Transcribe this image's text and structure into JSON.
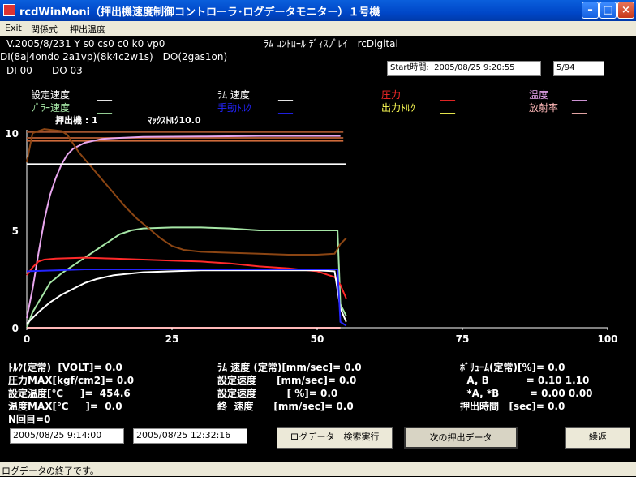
{
  "window": {
    "title": "rcdWinMoni（押出機速度制御コントローラ･ログデータモニター）１号機"
  },
  "menu": [
    "Exit",
    "関係式",
    "押出温度"
  ],
  "info": {
    "version": "V.2005/8/231 Y s0 cs0 c0 k0 vp0",
    "display_name": "ﾗﾑ ｺﾝﾄﾛｰﾙ ﾃﾞｨｽﾌﾟﾚｲ　rcDigital",
    "di_line": "DI(8aj4ondo 2a1vp)(8k4c2w1s)　DO(2gas1on)",
    "di": "DI 00",
    "do": "DO 03",
    "start_label": "Start時間:",
    "start_time": "2005/08/25 9:20:55",
    "page": "5/94"
  },
  "legend": {
    "set_speed": {
      "label": "設定速度",
      "value": "___"
    },
    "ram_speed": {
      "label": "ﾗﾑ 速度",
      "value": "___"
    },
    "pressure": {
      "label": "圧力",
      "value": "___"
    },
    "temperature": {
      "label": "温度",
      "value": "___"
    },
    "puller_speed": {
      "label": "ﾌﾟﾗｰ速度",
      "value": "___"
    },
    "manual_torque": {
      "label": "手動ﾄﾙｸ",
      "value": "___"
    },
    "output_torque": {
      "label": "出力ﾄﾙｸ",
      "value": "___"
    },
    "radiation": {
      "label": "放射率",
      "value": "___"
    },
    "extruder": "押出機 : 1",
    "max_torque": "ﾏｯｸｽﾄﾙｸ10.0"
  },
  "chart_data": {
    "type": "line",
    "xlim": [
      0,
      100
    ],
    "ylim": [
      0,
      10
    ],
    "x_ticks": [
      "0",
      "25",
      "50",
      "75",
      "100"
    ],
    "y_ticks": [
      "0",
      "5",
      "10"
    ],
    "series": [
      {
        "name": "温度",
        "color": "#e8a6ee",
        "points": [
          [
            0,
            0.5
          ],
          [
            1,
            2
          ],
          [
            2,
            3.8
          ],
          [
            3,
            5.5
          ],
          [
            4,
            6.8
          ],
          [
            5,
            7.7
          ],
          [
            6,
            8.4
          ],
          [
            7,
            8.9
          ],
          [
            8,
            9.2
          ],
          [
            10,
            9.5
          ],
          [
            13,
            9.7
          ],
          [
            16,
            9.75
          ],
          [
            20,
            9.8
          ],
          [
            30,
            9.82
          ],
          [
            40,
            9.85
          ],
          [
            50,
            9.85
          ],
          [
            54,
            9.85
          ]
        ]
      },
      {
        "name": "ﾌﾟﾗｰ速度",
        "color": "#a6e6a6",
        "points": [
          [
            0,
            0
          ],
          [
            1,
            0.8
          ],
          [
            2,
            1.3
          ],
          [
            3,
            1.8
          ],
          [
            4,
            2.3
          ],
          [
            6,
            2.8
          ],
          [
            8,
            3.2
          ],
          [
            10,
            3.6
          ],
          [
            12,
            4.0
          ],
          [
            14,
            4.4
          ],
          [
            16,
            4.8
          ],
          [
            18,
            5.0
          ],
          [
            20,
            5.1
          ],
          [
            25,
            5.15
          ],
          [
            30,
            5.15
          ],
          [
            35,
            5.1
          ],
          [
            40,
            5.0
          ],
          [
            45,
            5.0
          ],
          [
            50,
            5.0
          ],
          [
            53.5,
            5.0
          ],
          [
            54,
            1.2
          ],
          [
            55,
            0.6
          ]
        ]
      },
      {
        "name": "圧力",
        "color": "#ff2a2a",
        "points": [
          [
            0,
            2.7
          ],
          [
            1,
            3.1
          ],
          [
            2,
            3.4
          ],
          [
            3,
            3.5
          ],
          [
            5,
            3.55
          ],
          [
            10,
            3.6
          ],
          [
            15,
            3.55
          ],
          [
            20,
            3.5
          ],
          [
            25,
            3.45
          ],
          [
            30,
            3.4
          ],
          [
            35,
            3.3
          ],
          [
            40,
            3.15
          ],
          [
            45,
            3.05
          ],
          [
            50,
            2.9
          ],
          [
            53,
            2.6
          ],
          [
            54,
            2.2
          ],
          [
            55,
            1.5
          ]
        ]
      },
      {
        "name": "ﾗﾑ 速度",
        "color": "#ffffff",
        "points": [
          [
            0,
            0.2
          ],
          [
            2,
            0.8
          ],
          [
            4,
            1.3
          ],
          [
            6,
            1.7
          ],
          [
            8,
            2.0
          ],
          [
            10,
            2.3
          ],
          [
            12,
            2.5
          ],
          [
            15,
            2.7
          ],
          [
            20,
            2.85
          ],
          [
            25,
            2.9
          ],
          [
            30,
            2.95
          ],
          [
            35,
            2.95
          ],
          [
            40,
            2.95
          ],
          [
            45,
            2.95
          ],
          [
            50,
            2.95
          ],
          [
            53,
            2.9
          ],
          [
            54,
            1.0
          ],
          [
            55,
            0.3
          ]
        ]
      },
      {
        "name": "手動ﾄﾙｸ",
        "color": "#2424ff",
        "points": [
          [
            0,
            2.9
          ],
          [
            5,
            2.95
          ],
          [
            10,
            3.0
          ],
          [
            20,
            3.0
          ],
          [
            30,
            3.0
          ],
          [
            40,
            3.0
          ],
          [
            50,
            3.0
          ],
          [
            53.5,
            3.0
          ],
          [
            54,
            0.3
          ],
          [
            55,
            0.1
          ]
        ]
      },
      {
        "name": "出力ﾄﾙｸ",
        "color": "#8b4513",
        "points": [
          [
            0,
            8.5
          ],
          [
            1,
            10.0
          ],
          [
            3,
            10.2
          ],
          [
            6,
            10.1
          ],
          [
            7,
            9.9
          ],
          [
            9,
            9.0
          ],
          [
            11,
            8.3
          ],
          [
            13,
            7.6
          ],
          [
            15,
            6.9
          ],
          [
            17,
            6.2
          ],
          [
            19,
            5.6
          ],
          [
            21,
            5.1
          ],
          [
            23,
            4.6
          ],
          [
            25,
            4.2
          ],
          [
            27,
            4.0
          ],
          [
            30,
            3.9
          ],
          [
            35,
            3.85
          ],
          [
            40,
            3.8
          ],
          [
            45,
            3.75
          ],
          [
            50,
            3.75
          ],
          [
            53,
            3.8
          ],
          [
            54,
            4.3
          ],
          [
            55,
            4.6
          ]
        ]
      },
      {
        "name": "放射率",
        "color": "#ffb8b8",
        "points": [
          [
            0,
            0
          ],
          [
            5,
            0
          ],
          [
            10,
            0
          ],
          [
            20,
            0
          ],
          [
            30,
            0
          ],
          [
            40,
            0
          ],
          [
            50,
            0
          ],
          [
            54,
            0
          ]
        ]
      },
      {
        "name": "設定速度",
        "color": "#ffffff",
        "points": [
          [
            0,
            8.4
          ],
          [
            55,
            8.4
          ]
        ]
      }
    ],
    "reference_lines": [
      {
        "color": "#a0522d",
        "value": 10.05
      },
      {
        "color": "#a0522d",
        "value": 9.75
      },
      {
        "color": "#cd6a3a",
        "value": 9.6
      }
    ]
  },
  "readouts": {
    "left": [
      "ﾄﾙｸ(定常)  [VOLT]= 0.0",
      "圧力MAX[kgf/cm2]= 0.0",
      "設定温度[℃     ]=  454.6",
      "温度MAX[℃     ]=  0.0",
      "N回目=0"
    ],
    "middle": [
      "ﾗﾑ 速度 (定常)[mm/sec]= 0.0",
      "設定速度      [mm/sec]= 0.0",
      "設定速度         [ %]= 0.0",
      "終  速度      [mm/sec]= 0.0"
    ],
    "right": [
      "ﾎﾞﾘｭｰﾑ(定常)[%]= 0.0",
      "  A, B           = 0.10 1.10",
      "  *A, *B         = 0.00 0.00",
      "押出時間   [sec]= 0.0"
    ]
  },
  "search": {
    "from": "2005/08/25 9:14:00",
    "to": "2005/08/25 12:32:16",
    "search_button": "ログデータ　検索実行",
    "next_button": "次の押出データ",
    "repeat_button": "繰返"
  },
  "status": "ログデータの終了です。"
}
